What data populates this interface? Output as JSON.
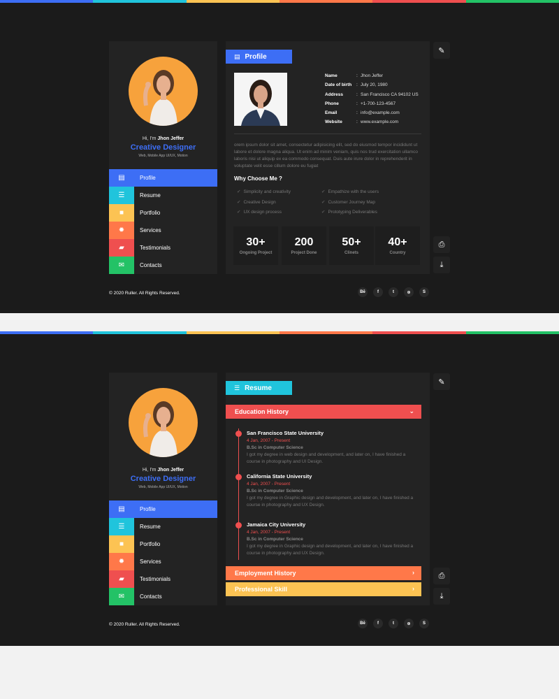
{
  "colors": {
    "topbar": [
      "#3d6ef5",
      "#20c4dc",
      "#fcc353",
      "#ff7849",
      "#ef4f4f",
      "#23c266"
    ],
    "nav_icons": [
      "#3d6ef5",
      "#20c4dc",
      "#fcc353",
      "#ff7849",
      "#ef4f4f",
      "#23c266"
    ],
    "accent": "#3d6ef5",
    "background": "#1b1b1b",
    "panel": "#232323"
  },
  "sidebar": {
    "greeting": "Hi, I'm ",
    "name": "Jhon Jeffer",
    "role": "Creative Designer",
    "subtitle": "Web, Mobile App UI/UX, Motion",
    "items": [
      {
        "label": "Profile",
        "icon": "id-card-icon"
      },
      {
        "label": "Resume",
        "icon": "menu-lines-icon"
      },
      {
        "label": "Portfolio",
        "icon": "briefcase-icon"
      },
      {
        "label": "Services",
        "icon": "gear-icon"
      },
      {
        "label": "Testimonials",
        "icon": "chat-icon"
      },
      {
        "label": "Contacts",
        "icon": "envelope-icon"
      }
    ]
  },
  "profile": {
    "title": "Profile",
    "info": [
      {
        "k": "Name",
        "v": "Jhon Jeffer"
      },
      {
        "k": "Date of birth",
        "v": "July 20, 1980"
      },
      {
        "k": "Address",
        "v": "San Francisco CA 94102 US"
      },
      {
        "k": "Phone",
        "v": "+1-700-123-4567"
      },
      {
        "k": "Email",
        "v": "info@example.com"
      },
      {
        "k": "Website",
        "v": "www.example.com"
      }
    ],
    "paragraph": "orem ipsum dolor sit amet, consectetur adipisicing elit, sed do eiusmod tempor incididunt ut labore et dolore magna aliqua. Ut enim ad minim veniam, quis nos trud exercitation ullamco laboris nisi ut aliquip ex ea commodo consequat. Duis aute irure dolor in reprehenderit in voluptate velit esse cillum dolore eu fugiat",
    "why_title": "Why Choose Me ?",
    "checks_left": [
      "Simplicity and creativity",
      "Creative Design",
      "UX design process"
    ],
    "checks_right": [
      "Empathize with the users",
      "Customer Journey Map",
      "Prototyping Deliverables"
    ],
    "stats": [
      {
        "n": "30+",
        "l": "Ongoing Project"
      },
      {
        "n": "200",
        "l": "Project Done"
      },
      {
        "n": "50+",
        "l": "Clinets"
      },
      {
        "n": "40+",
        "l": "Country"
      }
    ]
  },
  "resume": {
    "title": "Resume",
    "education_title": "Education History",
    "items": [
      {
        "u": "San Francisco State University",
        "d": "4 Jan, 2007 - Present",
        "g": "B.Sc in Computer Science",
        "p": "I got my degree in web design and development, and later on, I have finished a course in photography and UI Design."
      },
      {
        "u": "California State University",
        "d": "4 Jan, 2007 - Present",
        "g": "B.Sc in Computer Science",
        "p": "I got my degree in Graphic design and development, and later on, I have finished a course in photography and UX Design."
      },
      {
        "u": "Jamaica City University",
        "d": "4 Jan, 2007 - Present",
        "g": "B.Sc in Computer Science",
        "p": "I got my degree in Graphic design and development, and later on, I have finished a course in photography and UX Design."
      }
    ],
    "employment_title": "Employment History",
    "skill_title": "Professional Skill"
  },
  "footer": {
    "copyright": "© 2020 Ruller. All Rights Reserved.",
    "social": [
      "Bē",
      "f",
      "t",
      "⊛",
      "S"
    ]
  },
  "side_actions": [
    "pencil-icon",
    "print-icon",
    "download-icon"
  ]
}
